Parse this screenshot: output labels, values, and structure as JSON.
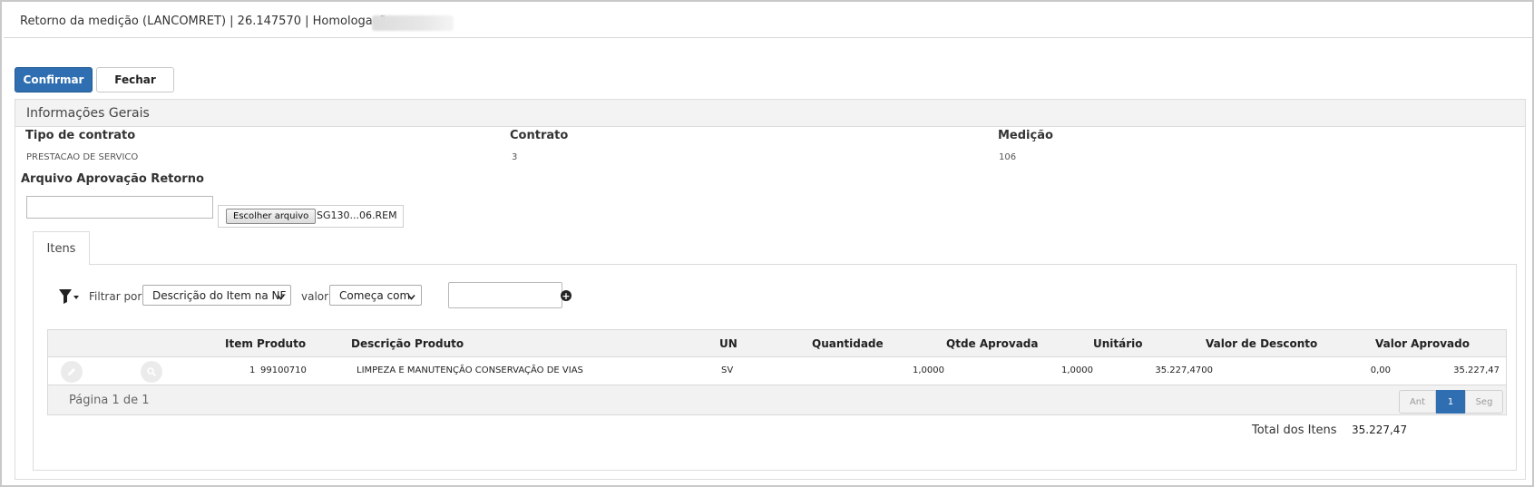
{
  "window": {
    "title": "Retorno da medição (LANCOMRET) | 26.147570 | Homologação"
  },
  "toolbar": {
    "confirm_label": "Confirmar",
    "close_label": "Fechar"
  },
  "general": {
    "title": "Informações Gerais",
    "contract_type_label": "Tipo de contrato",
    "contract_type_value": "PRESTACAO DE SERVICO",
    "contract_label": "Contrato",
    "contract_value": "3",
    "measurement_label": "Medição",
    "measurement_value": "106",
    "file_label": "Arquivo Aprovação Retorno",
    "file_button": "Escolher arquivo",
    "file_name": "SG130...06.REM"
  },
  "tabs": [
    {
      "label": "Itens"
    }
  ],
  "filter": {
    "filter_by_label": "Filtrar por",
    "field_selected": "Descrição do Item na NF",
    "value_label": "valor",
    "operator_selected": "Começa com",
    "value": ""
  },
  "grid": {
    "columns": [
      "Item",
      "Produto",
      "Descrição Produto",
      "UN",
      "Quantidade",
      "Qtde Aprovada",
      "Unitário",
      "Valor de Desconto",
      "Valor Aprovado"
    ],
    "rows": [
      {
        "item": "1",
        "produto": "99100710",
        "descricao": "LIMPEZA E MANUTENÇÃO CONSERVAÇÃO DE VIAS",
        "un": "SV",
        "quantidade": "1,0000",
        "qtde_aprovada": "1,0000",
        "unitario": "35.227,4700",
        "desconto": "0,00",
        "valor_aprovado": "35.227,47"
      }
    ],
    "page_label": "Página 1 de 1",
    "pager": {
      "prev": "Ant",
      "current": "1",
      "next": "Seg"
    }
  },
  "totals": {
    "label": "Total dos Itens",
    "value": "35.227,47"
  },
  "colors": {
    "primary": "#2f6fb1",
    "header_bg": "#f3f3f3",
    "border": "#dcdcdc"
  },
  "icons": [
    "filter-icon",
    "chevron-down-icon",
    "plus-circle-icon",
    "pencil-icon",
    "search-icon"
  ]
}
